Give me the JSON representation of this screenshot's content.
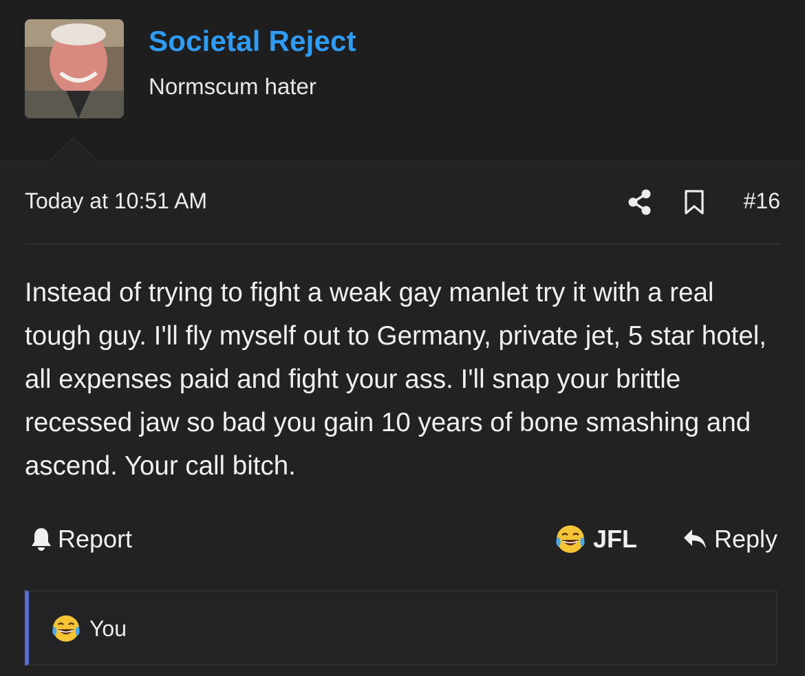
{
  "user": {
    "name": "Societal Reject",
    "title": "Normscum hater",
    "name_color": "#2f9cf4"
  },
  "post": {
    "timestamp": "Today at 10:51 AM",
    "number": "#16",
    "body": "Instead of trying to fight a weak gay manlet try it with a real tough guy. I'll fly myself out to Germany, private jet, 5 star hotel, all expenses paid and fight your ass. I'll snap your brittle recessed jaw so bad you gain 10 years of bone smashing and ascend. Your call bitch.",
    "icons": {
      "share": "share-icon",
      "bookmark": "bookmark-icon"
    }
  },
  "actions": {
    "report_label": "Report",
    "reaction_label": "JFL",
    "reply_label": "Reply",
    "icons": {
      "report": "bell-icon",
      "reaction": "crying-laughing-emoji-icon",
      "reply": "reply-arrow-icon"
    }
  },
  "reactions": {
    "summary": "You",
    "accent_color": "#5b6ccf"
  }
}
